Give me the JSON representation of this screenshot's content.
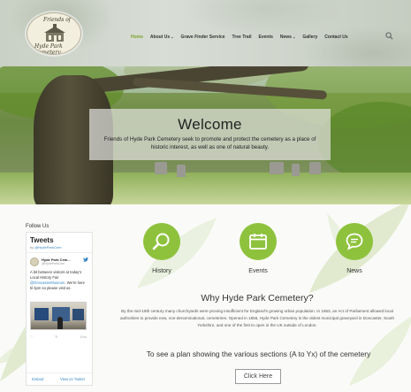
{
  "colors": {
    "accent": "#8ec23d",
    "active_nav": "#7aa32a",
    "link": "#3b88c3"
  },
  "logo": {
    "line1": "Friends of",
    "line2": "Hyde Park Cemetery",
    "icon": "cemetery-chapel-logo"
  },
  "nav": {
    "items": [
      {
        "label": "Home",
        "active": true
      },
      {
        "label": "About Us",
        "dropdown": true
      },
      {
        "label": "Grave Finder Service"
      },
      {
        "label": "Tree Trail"
      },
      {
        "label": "Events"
      },
      {
        "label": "News",
        "dropdown": true
      },
      {
        "label": "Gallery"
      },
      {
        "label": "Contact Us"
      }
    ],
    "caret": "⌄",
    "search_icon": "search-icon"
  },
  "hero": {
    "title": "Welcome",
    "text": "Friends of Hyde Park Cemetery seek to promote and protect the cemetery as a place of historic interest, as well as one of natural beauty."
  },
  "sidebar": {
    "follow_label": "Follow Us",
    "tweets": {
      "title": "Tweets",
      "by_prefix": "by ",
      "by_handle": "@HydeParkCem",
      "tweet": {
        "name": "Hyde Park Cem...",
        "handle": "@HydeParkCem",
        "body_before": "A bit between visitors at today's Local History Fair ",
        "mention": "@DoncasterMuseum",
        "body_after": ". We're here til 4pm so please visit us.",
        "actions": [
          "♡",
          "↻",
          "10m"
        ]
      },
      "embed_label": "Embed",
      "view_label": "View on Twitter"
    }
  },
  "features": [
    {
      "label": "History",
      "icon": "magnifier-icon"
    },
    {
      "label": "Events",
      "icon": "calendar-icon"
    },
    {
      "label": "News",
      "icon": "chat-bubble-icon"
    }
  ],
  "why": {
    "title": "Why Hyde Park Cemetery?",
    "text": "By the mid-19th century many churchyards were proving insufficient for England's growing urban population. In 1853, an Act of Parliament allowed local authorities to provide new, non-denominational, cemeteries. Opened in 1856, Hyde Park Cemetery is the oldest municipal graveyard in Doncaster, South Yorkshire, and one of the first to open in the UK outside of London."
  },
  "plan": {
    "text": "To see a plan showing the various sections (A to Yx) of the cemetery",
    "button_label": "Click Here"
  }
}
